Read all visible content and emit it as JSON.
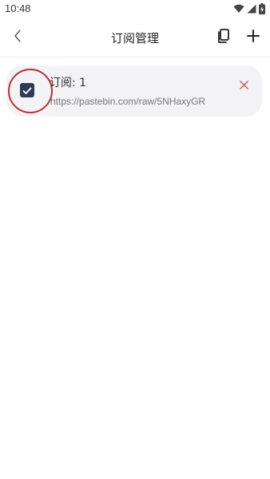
{
  "status_bar": {
    "time": "10:48",
    "icons": [
      "wifi-icon",
      "cellular-signal-icon",
      "battery-charging-icon"
    ]
  },
  "app_bar": {
    "title": "订阅管理",
    "back_icon": "back-chevron-icon",
    "actions": [
      "copy-icon",
      "add-icon"
    ]
  },
  "subscriptions": [
    {
      "name": "订阅: 1",
      "url": "https://pastebin.com/raw/5NHaxyGR",
      "checked": true
    }
  ],
  "colors": {
    "checkbox": "#2f3a55",
    "delete": "#d9534f",
    "card_background": "#f3f3f5",
    "highlight_ring": "#b43434"
  }
}
